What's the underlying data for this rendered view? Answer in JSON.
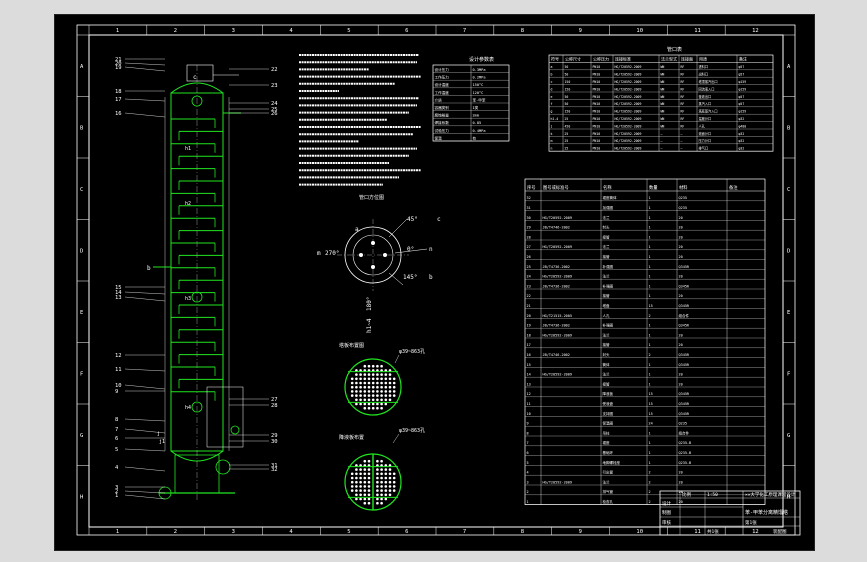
{
  "border": {
    "cols": [
      "1",
      "2",
      "3",
      "4",
      "5",
      "6",
      "7",
      "8",
      "9",
      "10",
      "11",
      "12"
    ],
    "rows": [
      "A",
      "B",
      "C",
      "D",
      "E",
      "F",
      "G",
      "H"
    ]
  },
  "balloons": {
    "left": [
      "21",
      "20",
      "19",
      "18",
      "17",
      "16",
      "15",
      "14",
      "13",
      "12",
      "11",
      "10",
      "9",
      "8",
      "7",
      "6",
      "5",
      "4",
      "3",
      "2",
      "1"
    ],
    "right": [
      "22",
      "23",
      "24",
      "25",
      "26",
      "27",
      "28",
      "29",
      "30",
      "31",
      "32"
    ]
  },
  "nozzle_tags": {
    "c": "c",
    "h1": "h1",
    "h2": "h2",
    "h3": "h3",
    "h4": "h4",
    "b": "b",
    "j": "j",
    "j1": "j1"
  },
  "orientation": {
    "title": "管口方位图",
    "a1": "45°",
    "a2": "270°",
    "a3": "180°",
    "a4": "0°",
    "a5": "145°",
    "l1": "a",
    "l2": "b",
    "l3": "c",
    "l4": "m",
    "l5": "n",
    "l6": "h1~4"
  },
  "trays": {
    "t1_title": "塔板布置图",
    "t1_dim": "φ39~863孔",
    "t2_title": "降液板布置",
    "t2_dim": "φ39~863孔"
  },
  "design_table": {
    "title": "设计参数表",
    "rows": [
      [
        "设计压力",
        "0.3MPa"
      ],
      [
        "工作压力",
        "0.2MPa"
      ],
      [
        "设计温度",
        "150°C"
      ],
      [
        "工作温度",
        "120°C"
      ],
      [
        "介质",
        "苯-甲苯"
      ],
      [
        "容器类别",
        "I类"
      ],
      [
        "腐蚀裕量",
        "2mm"
      ],
      [
        "焊接系数",
        "0.85"
      ],
      [
        "试验压力",
        "0.4MPa"
      ],
      [
        "保温",
        "有"
      ]
    ]
  },
  "nozzle_table": {
    "title": "管口表",
    "headers": [
      "符号",
      "公称尺寸",
      "公称压力",
      "连接标准",
      "法兰型式",
      "连接面",
      "用途",
      "备注"
    ],
    "rows": [
      [
        "a",
        "50",
        "PN10",
        "HG/T20592-2009",
        "WN",
        "RF",
        "进料口",
        "φ57"
      ],
      [
        "b",
        "50",
        "PN10",
        "HG/T20592-2009",
        "WN",
        "RF",
        "出料口",
        "φ57"
      ],
      [
        "c",
        "150",
        "PN10",
        "HG/T20592-2009",
        "WN",
        "RF",
        "塔顶蒸汽出口",
        "φ159"
      ],
      [
        "d",
        "150",
        "PN10",
        "HG/T20592-2009",
        "WN",
        "RF",
        "回流液入口",
        "φ159"
      ],
      [
        "e",
        "50",
        "PN10",
        "HG/T20592-2009",
        "WN",
        "RF",
        "釜液出口",
        "φ57"
      ],
      [
        "f",
        "50",
        "PN10",
        "HG/T20592-2009",
        "WN",
        "RF",
        "蒸汽入口",
        "φ57"
      ],
      [
        "g",
        "150",
        "PN10",
        "HG/T20592-2009",
        "WN",
        "RF",
        "塔底蒸汽入口",
        "φ159"
      ],
      [
        "h1-4",
        "25",
        "PN10",
        "HG/T20592-2009",
        "WN",
        "RF",
        "温度计口",
        "φ32"
      ],
      [
        "j",
        "450",
        "PN10",
        "HG/T20592-2009",
        "WN",
        "RF",
        "人孔",
        "φ480"
      ],
      [
        "k",
        "25",
        "PN10",
        "HG/T20592-2009",
        "—",
        "—",
        "液面计口",
        "φ32"
      ],
      [
        "m",
        "25",
        "PN10",
        "HG/T20592-2009",
        "—",
        "—",
        "压力计口",
        "φ32"
      ],
      [
        "n",
        "25",
        "PN10",
        "HG/T20592-2009",
        "—",
        "—",
        "排气口",
        "φ32"
      ]
    ]
  },
  "bom": {
    "headers": [
      "序号",
      "图号或标准号",
      "名称",
      "数量",
      "材料",
      "备注"
    ],
    "rows": [
      [
        "32",
        "",
        "裙座筒体",
        "1",
        "Q235",
        ""
      ],
      [
        "31",
        "",
        "加强圈",
        "1",
        "Q235",
        ""
      ],
      [
        "30",
        "HG/T20592-2009",
        "法兰",
        "1",
        "20",
        ""
      ],
      [
        "29",
        "JB/T4746-2002",
        "封头",
        "1",
        "20",
        ""
      ],
      [
        "28",
        "",
        "接管",
        "1",
        "20",
        ""
      ],
      [
        "27",
        "HG/T20592-2009",
        "法兰",
        "1",
        "20",
        ""
      ],
      [
        "26",
        "",
        "接管",
        "1",
        "20",
        ""
      ],
      [
        "25",
        "JB/T4736-2002",
        "补强圈",
        "1",
        "Q345R",
        ""
      ],
      [
        "24",
        "HG/T20592-2009",
        "法兰",
        "1",
        "20",
        ""
      ],
      [
        "23",
        "JB/T4736-2002",
        "补强圈",
        "1",
        "Q345R",
        ""
      ],
      [
        "22",
        "",
        "接管",
        "1",
        "20",
        ""
      ],
      [
        "21",
        "",
        "塔盘",
        "15",
        "Q345R",
        ""
      ],
      [
        "20",
        "HG/T21515-2005",
        "人孔",
        "2",
        "组合件",
        ""
      ],
      [
        "19",
        "JB/T4736-2002",
        "补强圈",
        "1",
        "Q345R",
        ""
      ],
      [
        "18",
        "HG/T20592-2009",
        "法兰",
        "1",
        "20",
        ""
      ],
      [
        "17",
        "",
        "接管",
        "1",
        "20",
        ""
      ],
      [
        "16",
        "JB/T4746-2002",
        "封头",
        "2",
        "Q345R",
        ""
      ],
      [
        "15",
        "",
        "筒体",
        "1",
        "Q345R",
        ""
      ],
      [
        "14",
        "HG/T20592-2009",
        "法兰",
        "1",
        "20",
        ""
      ],
      [
        "13",
        "",
        "接管",
        "1",
        "20",
        ""
      ],
      [
        "12",
        "",
        "降液板",
        "15",
        "Q345R",
        ""
      ],
      [
        "11",
        "",
        "受液盘",
        "15",
        "Q345R",
        ""
      ],
      [
        "10",
        "",
        "支持圈",
        "15",
        "Q345R",
        ""
      ],
      [
        "9",
        "",
        "保温圈",
        "24",
        "Q235",
        ""
      ],
      [
        "8",
        "",
        "吊柱",
        "1",
        "组合件",
        ""
      ],
      [
        "7",
        "",
        "裙座",
        "1",
        "Q235-B",
        ""
      ],
      [
        "6",
        "",
        "基础环",
        "1",
        "Q235-B",
        ""
      ],
      [
        "5",
        "",
        "地脚螺栓座",
        "1",
        "Q235-B",
        ""
      ],
      [
        "4",
        "",
        "引出管",
        "2",
        "20",
        ""
      ],
      [
        "3",
        "HG/T20592-2009",
        "法兰",
        "2",
        "20",
        ""
      ],
      [
        "2",
        "",
        "排气管",
        "2",
        "20",
        ""
      ],
      [
        "1",
        "",
        "检查孔",
        "2",
        "20",
        ""
      ]
    ]
  },
  "title_block": {
    "company": "××大学化工原理课程设计",
    "title": "苯-甲苯分离精馏塔",
    "r1": "设计",
    "r2": "制图",
    "r3": "审核",
    "r4": "比例",
    "r5": "1:50",
    "r6": "共1张",
    "r7": "第1张",
    "r8": "装配图"
  },
  "colors": {
    "sheet": "#000000",
    "lines": "#ffffff",
    "equipment": "#21e621",
    "page": "#dcdcdc"
  }
}
